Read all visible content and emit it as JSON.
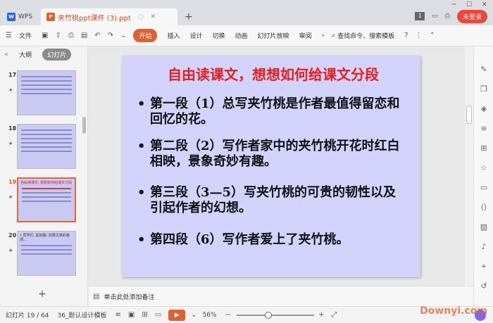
{
  "titlebar": {
    "app_tab": "WPS",
    "app_logo": "W",
    "doc_logo": "P",
    "doc_title": "夹竹桃ppt课件 (3).ppt",
    "login": "未登录",
    "badge": "1"
  },
  "ribbon": {
    "file": "文件",
    "start": "开始",
    "tabs": [
      "插入",
      "设计",
      "切换",
      "动画",
      "幻灯片放映",
      "审阅"
    ],
    "search": "查找命令、搜索模板"
  },
  "leftpanel": {
    "tab_outline": "大纲",
    "tab_slides": "幻灯片",
    "slides": [
      {
        "num": "17",
        "current": false
      },
      {
        "num": "18",
        "current": false
      },
      {
        "num": "19",
        "current": true,
        "text": "自由读课文, 想想如何给课文分段"
      },
      {
        "num": "20",
        "current": false,
        "text": "• 同学们, 起初聊, 如果文章的格调..."
      }
    ]
  },
  "slide": {
    "title": "自由读课文，想想如何给课文分段",
    "bullets": [
      "第一段（1）总写夹竹桃是作者最值得留恋和回忆的花。",
      "第二段（2）写作者家中的夹竹桃开花时红白相映，景象奇妙有趣。",
      "第三段（3—5）写夹竹桃的可贵的韧性以及引起作者的幻想。",
      "第四段（6）写作者爱上了夹竹桃。"
    ]
  },
  "notes": {
    "placeholder": "单击此处添加备注"
  },
  "statusbar": {
    "slide_info": "幻灯片 19 / 64",
    "template": "36_默认设计模板",
    "zoom": "56%",
    "watermark": "Downyi.com"
  },
  "colors": {
    "accent": "#e0612f",
    "slide_bg": "#d3d2fb",
    "title_red": "#e81e1e"
  }
}
